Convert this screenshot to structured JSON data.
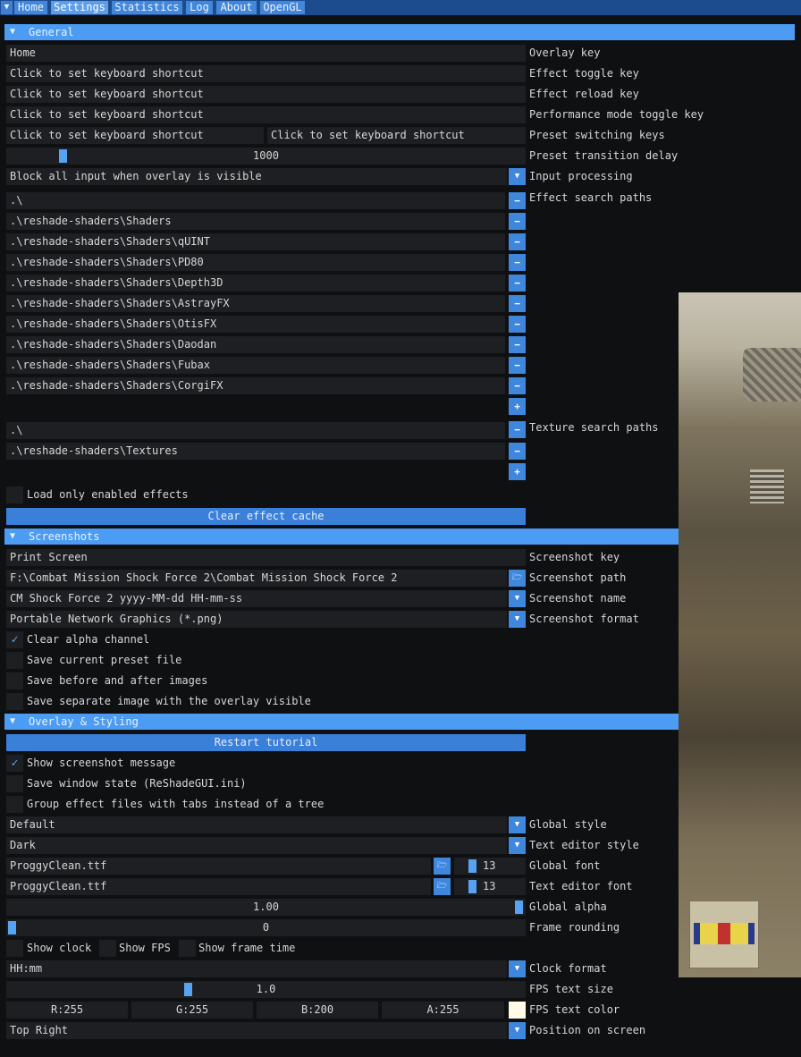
{
  "tabs": [
    "Home",
    "Settings",
    "Statistics",
    "Log",
    "About",
    "OpenGL"
  ],
  "menu_icon": "triangle-down-icon",
  "sections": {
    "general": "General",
    "screenshots": "Screenshots",
    "overlay": "Overlay & Styling"
  },
  "general": {
    "overlay_key": {
      "value": "Home",
      "label": "Overlay key"
    },
    "effect_toggle_key": {
      "value": "Click to set keyboard shortcut",
      "label": "Effect toggle key"
    },
    "effect_reload_key": {
      "value": "Click to set keyboard shortcut",
      "label": "Effect reload key"
    },
    "performance_mode_key": {
      "value": "Click to set keyboard shortcut",
      "label": "Performance mode toggle key"
    },
    "preset_switching": {
      "value1": "Click to set keyboard shortcut",
      "value2": "Click to set keyboard shortcut",
      "label": "Preset switching keys"
    },
    "preset_transition": {
      "value": "1000",
      "label": "Preset transition delay",
      "slider_fraction": 0.1
    },
    "input_processing": {
      "value": "Block all input when overlay is visible",
      "label": "Input processing"
    },
    "effect_search_label": "Effect search paths",
    "effect_paths": [
      ".\\",
      ".\\reshade-shaders\\Shaders",
      ".\\reshade-shaders\\Shaders\\qUINT",
      ".\\reshade-shaders\\Shaders\\PD80",
      ".\\reshade-shaders\\Shaders\\Depth3D",
      ".\\reshade-shaders\\Shaders\\AstrayFX",
      ".\\reshade-shaders\\Shaders\\OtisFX",
      ".\\reshade-shaders\\Shaders\\Daodan",
      ".\\reshade-shaders\\Shaders\\Fubax",
      ".\\reshade-shaders\\Shaders\\CorgiFX"
    ],
    "texture_search_label": "Texture search paths",
    "texture_paths": [
      ".\\",
      ".\\reshade-shaders\\Textures"
    ],
    "load_only_enabled": {
      "label": "Load only enabled effects",
      "checked": false
    },
    "clear_cache": "Clear effect cache"
  },
  "screenshots": {
    "key": {
      "value": "Print Screen",
      "label": "Screenshot key"
    },
    "path": {
      "value": "F:\\Combat Mission Shock Force 2\\Combat Mission Shock Force 2",
      "label": "Screenshot path"
    },
    "name": {
      "value": "CM Shock Force 2 yyyy-MM-dd HH-mm-ss",
      "label": "Screenshot name"
    },
    "format": {
      "value": "Portable Network Graphics (*.png)",
      "label": "Screenshot format"
    },
    "clear_alpha": {
      "label": "Clear alpha channel",
      "checked": true
    },
    "save_preset": {
      "label": "Save current preset file",
      "checked": false
    },
    "save_before_after": {
      "label": "Save before and after images",
      "checked": false
    },
    "save_separate": {
      "label": "Save separate image with the overlay visible",
      "checked": false
    }
  },
  "overlay": {
    "restart_tutorial": "Restart tutorial",
    "show_screenshot_msg": {
      "label": "Show screenshot message",
      "checked": true
    },
    "save_window_state": {
      "label": "Save window state (ReShadeGUI.ini)",
      "checked": false
    },
    "group_effects": {
      "label": "Group effect files with tabs instead of a tree",
      "checked": false
    },
    "global_style": {
      "value": "Default",
      "label": "Global style"
    },
    "text_editor_style": {
      "value": "Dark",
      "label": "Text editor style"
    },
    "global_font": {
      "value": "ProggyClean.ttf",
      "size": "13",
      "label": "Global font"
    },
    "text_editor_font": {
      "value": "ProggyClean.ttf",
      "size": "13",
      "label": "Text editor font"
    },
    "global_alpha": {
      "value": "1.00",
      "label": "Global alpha",
      "slider_fraction": 1.0
    },
    "frame_rounding": {
      "value": "0",
      "label": "Frame rounding",
      "slider_fraction": 0.0
    },
    "show_clock": {
      "label": "Show clock",
      "checked": false
    },
    "show_fps": {
      "label": "Show FPS",
      "checked": false
    },
    "show_frame_time": {
      "label": "Show frame time",
      "checked": false
    },
    "clock_format": {
      "value": "HH:mm",
      "label": "Clock format"
    },
    "fps_text_size": {
      "value": "1.0",
      "label": "FPS text size",
      "slider_fraction": 0.35
    },
    "fps_text_color": {
      "r": "R:255",
      "g": "G:255",
      "b": "B:200",
      "a": "A:255",
      "label": "FPS text color",
      "swatch": "#fffbe6"
    },
    "position_on_screen": {
      "value": "Top Right",
      "label": "Position on screen"
    }
  },
  "colors": {
    "accent": "#4b9cf2",
    "button": "#3f86dd",
    "frame_bg": "#1d1f22",
    "window_bg": "#0f1012"
  }
}
